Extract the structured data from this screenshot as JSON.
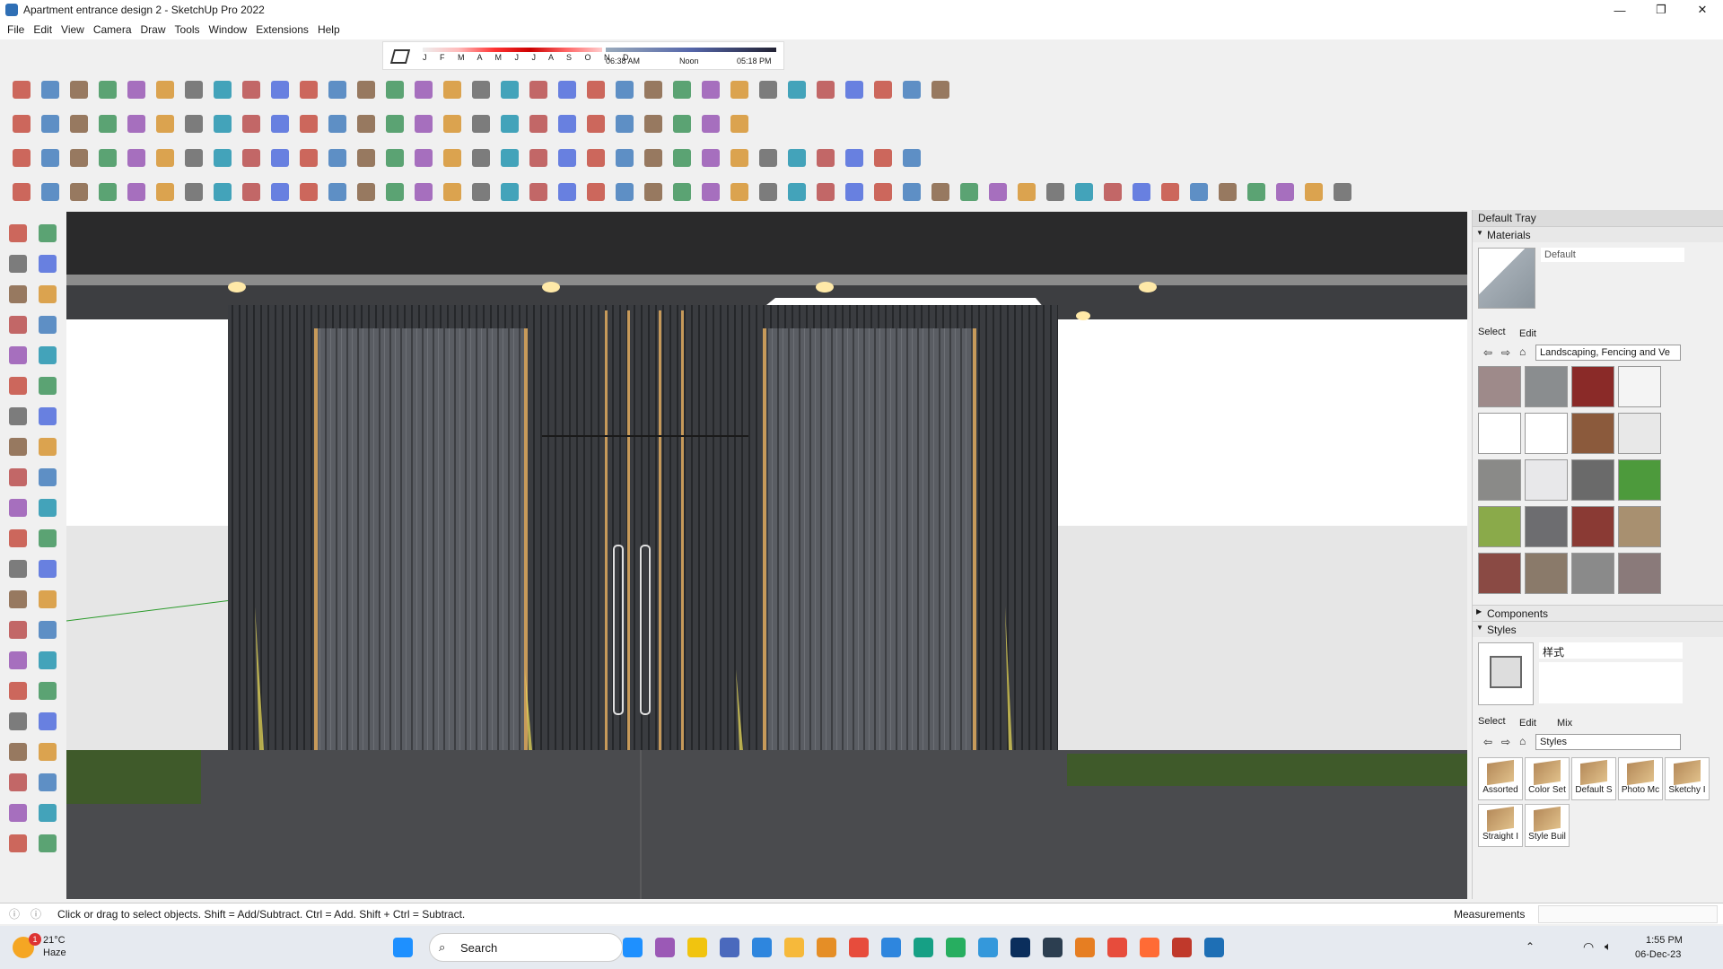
{
  "window": {
    "title": "Apartment entrance design 2 - SketchUp Pro 2022",
    "minimize": "—",
    "maximize": "❐",
    "close": "✕"
  },
  "menu": [
    "File",
    "Edit",
    "View",
    "Camera",
    "Draw",
    "Tools",
    "Window",
    "Extensions",
    "Help"
  ],
  "shadow_bar": {
    "months": "J F M A M J J A S O N D",
    "sunrise": "06:38 AM",
    "noon": "Noon",
    "sunset": "05:18 PM"
  },
  "toolbar_icons": {
    "row1": [
      "freehand-icon",
      "arc-icon",
      "pie-icon",
      "offset-icon",
      "polygon-icon",
      "rectangle-icon",
      "followme-icon",
      "curve-icon",
      "sphere-icon",
      "loft-icon",
      "bezier-icon",
      "line-icon",
      "spline-icon",
      "wall-icon",
      "roof-icon",
      "stairs-icon",
      "railing-icon",
      "hand-icon",
      "profile-icon",
      "trim-icon",
      "extend-icon",
      "split-icon",
      "join-icon",
      "fillet-icon",
      "chamfer-icon",
      "explode-icon",
      "array-icon",
      "hatch-icon",
      "grid-icon",
      "building-icon",
      "house-icon",
      "garage-icon",
      "store-icon"
    ],
    "row2": [
      "zoom-icon",
      "select-icon",
      "eraser-icon",
      "pencil-icon",
      "shape-icon",
      "paint-icon",
      "move-icon",
      "rotate-icon",
      "scale-icon",
      "pushpull-icon",
      "tape-icon",
      "text-icon",
      "paint-bucket-icon",
      "orbit-icon",
      "pan-icon",
      "zoom-window-icon",
      "zoom-extents-icon",
      "camera-icon",
      "layer-icon",
      "section-icon",
      "ruby-icon",
      "user-icon",
      "link-icon",
      "extension-icon",
      "color-icon",
      "magic-icon"
    ],
    "row3": [
      "home-icon",
      "box-icon",
      "component-icon",
      "group-icon",
      "layout-icon",
      "grid-icon",
      "frame-icon",
      "cut-icon",
      "eraser-icon",
      "ring-icon",
      "face-icon",
      "sphere-icon",
      "donut-icon",
      "shell-icon",
      "select-icon",
      "orbit-icon",
      "redo-icon",
      "blue-icon",
      "purple-icon",
      "material-icon",
      "tree-icon",
      "sun-icon",
      "timer-icon",
      "gear-icon",
      "settings-icon",
      "window-icon",
      "frame-icon",
      "print-icon",
      "export-icon",
      "wood-icon",
      "fence-icon",
      "road-icon"
    ],
    "row4": [
      "star-icon",
      "lamp-icon",
      "circle-icon",
      "tripod-icon",
      "sparkle-icon",
      "dome-icon",
      "layers-icon",
      "copy-icon",
      "scale-icon",
      "box-icon",
      "box2-icon",
      "sphere-icon",
      "lock-icon",
      "clipboard-icon",
      "cube-icon",
      "plane-icon",
      "tile-icon",
      "paint-icon",
      "stack-icon",
      "undo-icon",
      "cut-icon",
      "frame-icon",
      "bag-icon",
      "door-icon",
      "wrench-icon",
      "pole-icon",
      "chain-icon",
      "move-icon",
      "cross-icon",
      "star-icon",
      "pyramid-icon",
      "triangle-icon",
      "cone-icon",
      "loop-icon",
      "curl-icon",
      "circle-icon",
      "rope-icon",
      "dots-icon",
      "bucket-icon",
      "target-icon",
      "grid-icon",
      "texture-icon",
      "map-icon",
      "hatch-icon",
      "arrows-icon",
      "curve-icon",
      "tower-icon"
    ]
  },
  "left_tools": [
    "select-icon",
    "orbit-icon",
    "paint-icon",
    "eraser-icon",
    "component-icon",
    "tape-icon",
    "pencil-icon",
    "freehand-icon",
    "rectangle-icon",
    "rotated-rect-icon",
    "circle-icon",
    "polygon-icon",
    "arc-icon",
    "arc2-icon",
    "arc3-icon",
    "pie-icon",
    "move-icon",
    "pushpull-icon",
    "rotate-icon",
    "followme-icon",
    "scale-icon",
    "offset-icon",
    "tape-measure-icon",
    "dimension-icon",
    "protractor-icon",
    "text-icon",
    "axes-icon",
    "3dtext-icon",
    "orbit2-icon",
    "pan-icon",
    "zoom-icon",
    "zoom-window-icon",
    "zoom-extents-icon",
    "previous-icon",
    "position-camera-icon",
    "look-around-icon",
    "walk-icon",
    "section-icon",
    "layer-icon",
    "layer2-icon",
    "stack-icon",
    "stack2-icon"
  ],
  "tray": {
    "title": "Default Tray",
    "materials": {
      "header": "Materials",
      "current": "Default",
      "tabs": [
        "Select",
        "Edit"
      ],
      "library": "Landscaping, Fencing and Ve",
      "swatch_colors": [
        "#9e8a8a",
        "#8a8d8f",
        "#8a2a28",
        "#f4f4f4",
        "#ffffff",
        "#ffffff",
        "#8b5a3c",
        "#e8e8e8",
        "#8a8a88",
        "#e8e8ea",
        "#6a6a6a",
        "#4d9a3c",
        "#8aaa4a",
        "#6d6d70",
        "#8a3a34",
        "#a89070",
        "#8a4a44",
        "#8a7a6a",
        "#8a8a8a",
        "#8a7a7a"
      ]
    },
    "components": {
      "header": "Components"
    },
    "styles": {
      "header": "Styles",
      "current": "样式",
      "tabs": [
        "Select",
        "Edit",
        "Mix"
      ],
      "library": "Styles",
      "tiles": [
        "Assorted",
        "Color Set",
        "Default S",
        "Photo Mc",
        "Sketchy I",
        "Straight I",
        "Style Buil"
      ]
    }
  },
  "status": {
    "hint": "Click or drag to select objects. Shift = Add/Subtract. Ctrl = Add. Shift + Ctrl = Subtract.",
    "measurements_label": "Measurements",
    "measurements_value": ""
  },
  "taskbar": {
    "weather_temp": "21°C",
    "weather_desc": "Haze",
    "badge": "1",
    "search": "Search",
    "time": "1:55 PM",
    "date": "06-Dec-23",
    "apps": [
      "start-icon",
      "search-icon",
      "gallery-icon",
      "explorer-icon",
      "teams-icon",
      "calculator-icon",
      "sticky-notes-icon",
      "folder-icon",
      "opera-icon",
      "telegram-icon",
      "sketchbook-icon",
      "greenshot-icon",
      "vscode-icon",
      "photoshop-icon",
      "affinity-icon",
      "chrome-icon",
      "pinterest-icon",
      "soundcloud-icon",
      "sketchup-icon",
      "sketchup2-icon"
    ]
  }
}
